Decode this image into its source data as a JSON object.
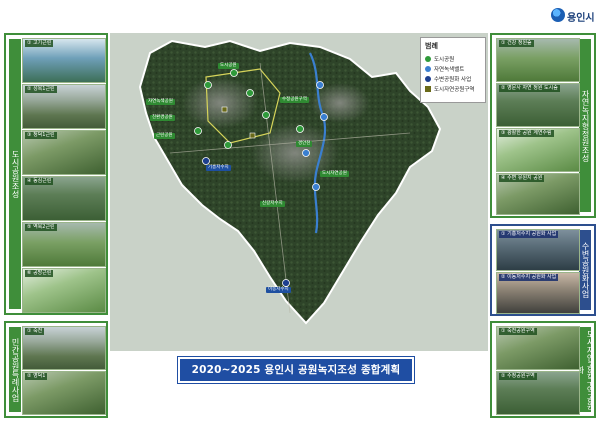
{
  "header": {
    "logo_text": "용인시"
  },
  "title": "2020~2025 용인시 공원녹지조성 종합계획",
  "left_top_panel": {
    "vertical_label": "도시공원조성",
    "items": [
      {
        "label": "① 고기근린",
        "scene": "sea"
      },
      {
        "label": "② 성복1근린",
        "scene": "city"
      },
      {
        "label": "③ 청덕1근린",
        "scene": "hill"
      },
      {
        "label": "④ 동심근린",
        "scene": "green"
      },
      {
        "label": "⑤ 역북2근린",
        "scene": "field"
      },
      {
        "label": "⑥ 공방근린",
        "scene": "park"
      }
    ]
  },
  "left_bottom_panel": {
    "vertical_label": "민간공원특례사업",
    "items": [
      {
        "label": "① 죽전",
        "scene": "city"
      },
      {
        "label": "② 영덕1",
        "scene": "hill"
      }
    ]
  },
  "right_top_panel": {
    "vertical_label": "자연녹지형정원조성",
    "items": [
      {
        "label": "① 건강 정원숲",
        "scene": "field"
      },
      {
        "label": "② 영문사 자연 정원 도시숲",
        "scene": "green"
      },
      {
        "label": "③ 광활한 공원 계연수림",
        "scene": "park"
      },
      {
        "label": "④ 수변 유원지 공원",
        "scene": "hill"
      }
    ]
  },
  "right_mid_panel": {
    "vertical_label": "수변공원화사업",
    "items": [
      {
        "label": "① 기흥저수지 공원화 사업",
        "scene": "water"
      },
      {
        "label": "② 이동저수지 공원화 사업",
        "scene": "dusk"
      }
    ]
  },
  "right_bottom_panel": {
    "vertical_label": "도시자연공원구역공원화",
    "items": [
      {
        "label": "① 죽전공원구역",
        "scene": "hill"
      },
      {
        "label": "② 수정공원구역",
        "scene": "green"
      }
    ]
  },
  "legend": {
    "title": "범례",
    "items": [
      {
        "label": "도시공원",
        "color": "#2f9a3a",
        "shape": "dot"
      },
      {
        "label": "자연녹색밸트",
        "color": "#3a7fd0",
        "shape": "dot"
      },
      {
        "label": "수변공원화 사업",
        "color": "#1d3f8f",
        "shape": "dot"
      },
      {
        "label": "도시자연공원구역",
        "color": "#6a6a1a",
        "shape": "square"
      }
    ]
  },
  "map_labels": [
    {
      "text": "도시공원",
      "color": "g"
    },
    {
      "text": "자연녹색공원",
      "color": "g"
    },
    {
      "text": "친환경공원",
      "color": "g"
    },
    {
      "text": "근린공원",
      "color": "g"
    },
    {
      "text": "수정공원구역",
      "color": "g"
    },
    {
      "text": "기흥저수지",
      "color": "b"
    },
    {
      "text": "경안천",
      "color": "g"
    },
    {
      "text": "신갈저수지",
      "color": "g"
    },
    {
      "text": "도시자연공원",
      "color": "g"
    },
    {
      "text": "이동저수지",
      "color": "b"
    }
  ],
  "colors": {
    "panel_green": "#3f8e3a",
    "panel_blue": "#2d4f8e",
    "banner": "#1f4ea3"
  }
}
